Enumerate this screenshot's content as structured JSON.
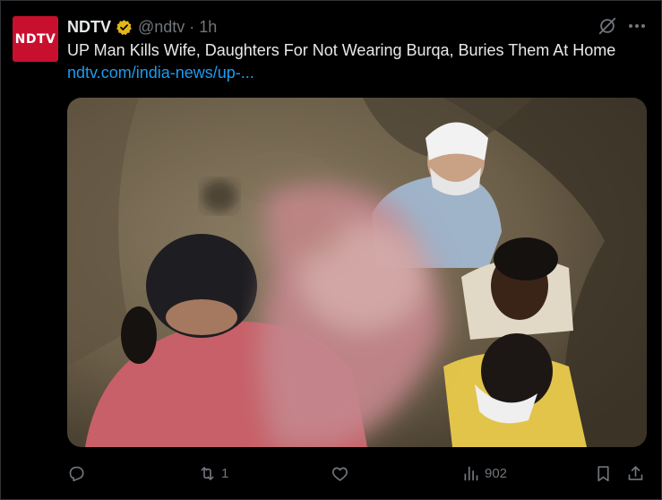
{
  "tweet": {
    "avatar_text": "NDTV",
    "author_name": "NDTV",
    "handle": "@ndtv",
    "separator": "·",
    "time": "1h",
    "text": "UP Man Kills Wife, Daughters For Not Wearing Burqa, Buries Them At Home",
    "link": "ndtv.com/india-news/up-..."
  },
  "actions": {
    "reply_count": "",
    "retweet_count": "1",
    "like_count": "",
    "views_count": "902"
  },
  "colors": {
    "background": "#000000",
    "text": "#e7e9ea",
    "muted": "#71767b",
    "link": "#1d9bf0",
    "verified_gold": "#e2b719",
    "avatar_red": "#c8102e"
  },
  "icons": [
    "verified-badge-icon",
    "grok-icon",
    "more-icon",
    "reply-icon",
    "retweet-icon",
    "like-icon",
    "views-icon",
    "bookmark-icon",
    "share-icon"
  ]
}
